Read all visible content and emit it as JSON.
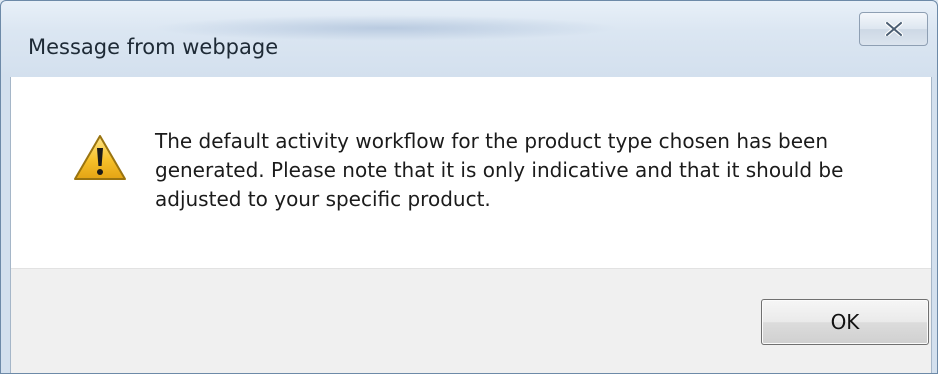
{
  "dialog": {
    "title": "Message from webpage",
    "close_icon": "close-x-icon",
    "warning_icon": "warning-triangle-icon",
    "message": "The default activity workflow for the product type chosen has been generated. Please note that it is only indicative and that it should be adjusted to your specific product.",
    "ok_label": "OK"
  },
  "colors": {
    "title_text": "#1e2a36",
    "warning_fill": "#f7c12a",
    "warning_outline": "#9a7410",
    "footer_bg": "#f0f0f0"
  }
}
